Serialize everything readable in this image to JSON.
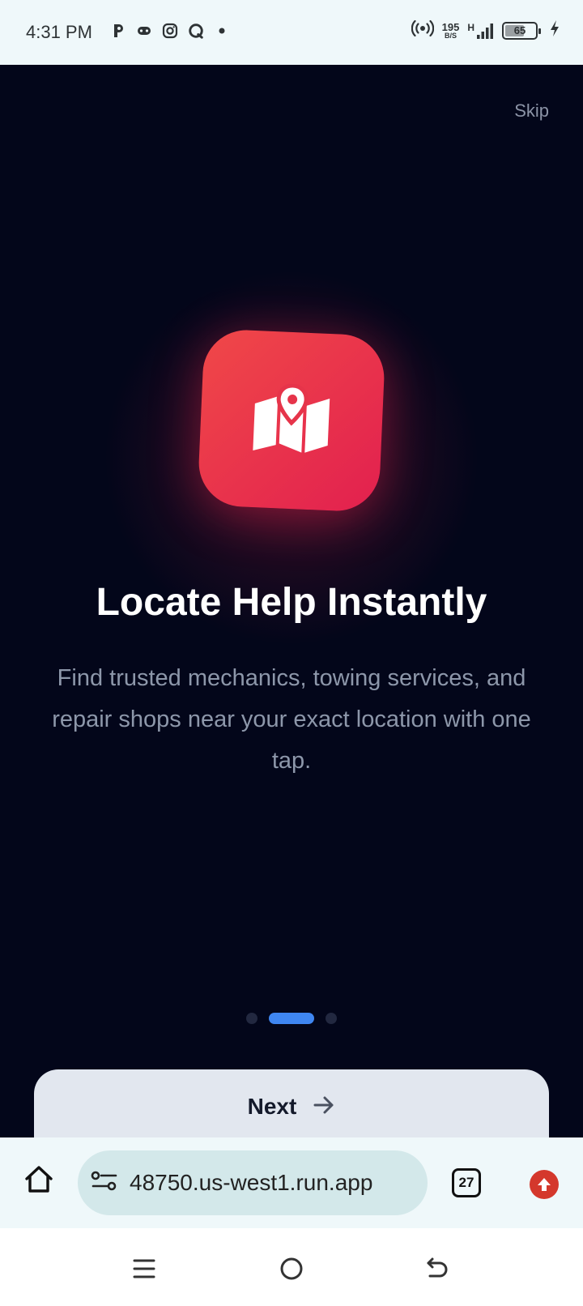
{
  "status": {
    "time": "4:31 PM",
    "net_speed_value": "195",
    "net_speed_unit": "B/S",
    "network_type": "H",
    "battery_level": "65",
    "battery_fraction": 0.65,
    "left_icons": [
      "p-app-icon",
      "gamepad-icon",
      "instagram-icon",
      "chat-bubble-icon",
      "dot-icon"
    ],
    "right_icons": [
      "hotspot-icon",
      "signal-icon",
      "battery-icon",
      "charging-bolt-icon"
    ]
  },
  "onboarding": {
    "skip_label": "Skip",
    "icon": "map-pin-icon",
    "title": "Locate Help Instantly",
    "description": "Find trusted mechanics, towing services, and repair shops near your exact location with one tap.",
    "current_page": 2,
    "total_pages": 3,
    "next_label": "Next",
    "next_icon": "arrow-right-icon",
    "colors": {
      "background": "#03061a",
      "accent": "#e2204f",
      "active_dot": "#3f86f1"
    }
  },
  "browser": {
    "url": "48750.us-west1.run.app",
    "tab_count": "27"
  },
  "navbar": {
    "icons": [
      "menu-icon",
      "home-circle-icon",
      "back-icon"
    ]
  }
}
